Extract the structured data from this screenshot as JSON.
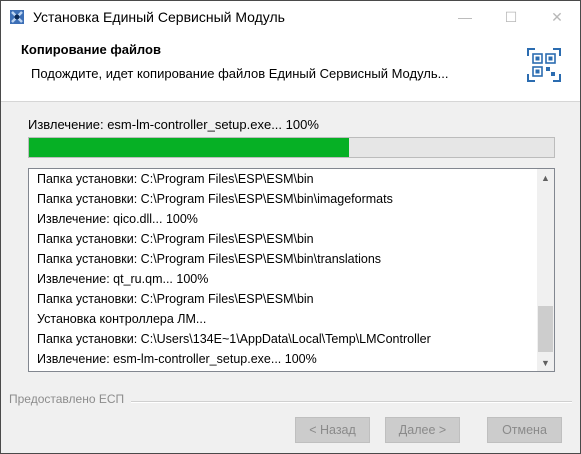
{
  "window": {
    "title": "Установка Единый Сервисный Модуль",
    "controls": {
      "minimize": "—",
      "maximize": "☐",
      "close": "✕"
    }
  },
  "header": {
    "title": "Копирование файлов",
    "subtitle": "Подождите, идет копирование файлов Единый Сервисный Модуль..."
  },
  "progress": {
    "label": "Извлечение: esm-lm-controller_setup.exe... 100%",
    "fraction": 0.61,
    "color": "#06b025"
  },
  "log": {
    "lines": [
      "Папка установки: C:\\Program Files\\ESP\\ESM\\bin",
      "Папка установки: C:\\Program Files\\ESP\\ESM\\bin\\imageformats",
      "Извлечение: qico.dll... 100%",
      "Папка установки: C:\\Program Files\\ESP\\ESM\\bin",
      "Папка установки: C:\\Program Files\\ESP\\ESM\\bin\\translations",
      "Извлечение: qt_ru.qm... 100%",
      "Папка установки: C:\\Program Files\\ESP\\ESM\\bin",
      "Установка контроллера ЛМ...",
      "Папка установки: C:\\Users\\134E~1\\AppData\\Local\\Temp\\LMController",
      "Извлечение: esm-lm-controller_setup.exe... 100%"
    ]
  },
  "footer": {
    "branding": "Предоставлено ЕСП",
    "back_label": "< Назад",
    "next_label": "Далее >",
    "cancel_label": "Отмена"
  }
}
